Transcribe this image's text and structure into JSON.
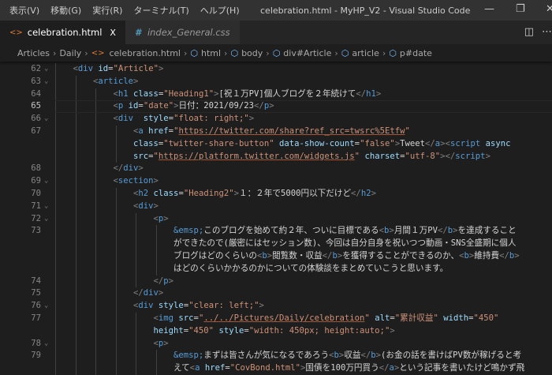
{
  "menu": [
    "表示(V)",
    "移動(G)",
    "実行(R)",
    "ターミナル(T)",
    "ヘルプ(H)"
  ],
  "window_title": "celebration.html - MyHP_V2 - Visual Studio Code",
  "tabs": [
    {
      "label": "celebration.html",
      "close": "X",
      "active": true
    },
    {
      "label": "index_General.css",
      "active": false
    }
  ],
  "breadcrumb": [
    "Articles",
    "Daily",
    "celebration.html",
    "html",
    "body",
    "div#Article",
    "article",
    "p#date"
  ],
  "current_line": 65,
  "lines": [
    {
      "n": 62,
      "fold": true,
      "indent": 1,
      "rows": [
        [
          [
            "<",
            "p"
          ],
          [
            "div",
            "t"
          ],
          [
            " id",
            "a"
          ],
          [
            "=",
            "x"
          ],
          [
            "\"Article\"",
            "s"
          ],
          [
            ">",
            "p"
          ]
        ]
      ]
    },
    {
      "n": 63,
      "fold": true,
      "indent": 2,
      "rows": [
        [
          [
            "<",
            "p"
          ],
          [
            "article",
            "t"
          ],
          [
            ">",
            "p"
          ]
        ]
      ]
    },
    {
      "n": 64,
      "fold": false,
      "indent": 3,
      "rows": [
        [
          [
            "<",
            "p"
          ],
          [
            "h1",
            "t"
          ],
          [
            " class",
            "a"
          ],
          [
            "=",
            "x"
          ],
          [
            "\"Heading1\"",
            "s"
          ],
          [
            ">",
            "p"
          ],
          [
            "[祝１万PV]個人ブログを２年続けて",
            "x"
          ],
          [
            "</",
            "p"
          ],
          [
            "h1",
            "t"
          ],
          [
            ">",
            "p"
          ]
        ]
      ]
    },
    {
      "n": 65,
      "fold": false,
      "indent": 3,
      "rows": [
        [
          [
            "<",
            "p"
          ],
          [
            "p",
            "t"
          ],
          [
            " id",
            "a"
          ],
          [
            "=",
            "x"
          ],
          [
            "\"date\"",
            "s"
          ],
          [
            ">",
            "p"
          ],
          [
            "日付：2021/09/23",
            "x"
          ],
          [
            "</",
            "p"
          ],
          [
            "p",
            "t"
          ],
          [
            ">",
            "p"
          ]
        ]
      ]
    },
    {
      "n": 66,
      "fold": true,
      "indent": 3,
      "rows": [
        [
          [
            "<",
            "p"
          ],
          [
            "div",
            "t"
          ],
          [
            "  style",
            "a"
          ],
          [
            "=",
            "x"
          ],
          [
            "\"float: right;\"",
            "s"
          ],
          [
            ">",
            "p"
          ]
        ]
      ]
    },
    {
      "n": 67,
      "fold": false,
      "indent": 4,
      "rows": [
        [
          [
            "<",
            "p"
          ],
          [
            "a",
            "t"
          ],
          [
            " href",
            "a"
          ],
          [
            "=",
            "x"
          ],
          [
            "\"",
            "s"
          ],
          [
            "https://twitter.com/share?ref_src=twsrc%5Etfw",
            "u"
          ],
          [
            "\"",
            "s"
          ]
        ],
        [
          [
            "class",
            "a"
          ],
          [
            "=",
            "x"
          ],
          [
            "\"twitter-share-button\"",
            "s"
          ],
          [
            " data-show-count",
            "a"
          ],
          [
            "=",
            "x"
          ],
          [
            "\"false\"",
            "s"
          ],
          [
            ">",
            "p"
          ],
          [
            "Tweet",
            "x"
          ],
          [
            "</",
            "p"
          ],
          [
            "a",
            "t"
          ],
          [
            ">",
            "p"
          ],
          [
            "<",
            "p"
          ],
          [
            "script",
            "t"
          ],
          [
            " async",
            "a"
          ]
        ],
        [
          [
            "src",
            "a"
          ],
          [
            "=",
            "x"
          ],
          [
            "\"",
            "s"
          ],
          [
            "https://platform.twitter.com/widgets.js",
            "u"
          ],
          [
            "\"",
            "s"
          ],
          [
            " charset",
            "a"
          ],
          [
            "=",
            "x"
          ],
          [
            "\"utf-8\"",
            "s"
          ],
          [
            "></",
            "p"
          ],
          [
            "script",
            "t"
          ],
          [
            ">",
            "p"
          ]
        ]
      ]
    },
    {
      "n": 68,
      "fold": false,
      "indent": 3,
      "rows": [
        [
          [
            "</",
            "p"
          ],
          [
            "div",
            "t"
          ],
          [
            ">",
            "p"
          ]
        ]
      ]
    },
    {
      "n": 69,
      "fold": true,
      "indent": 3,
      "rows": [
        [
          [
            "<",
            "p"
          ],
          [
            "section",
            "t"
          ],
          [
            ">",
            "p"
          ]
        ]
      ]
    },
    {
      "n": 70,
      "fold": false,
      "indent": 4,
      "rows": [
        [
          [
            "<",
            "p"
          ],
          [
            "h2",
            "t"
          ],
          [
            " class",
            "a"
          ],
          [
            "=",
            "x"
          ],
          [
            "\"Heading2\"",
            "s"
          ],
          [
            ">",
            "p"
          ],
          [
            "１：２年で5000円以下だけど",
            "x"
          ],
          [
            "</",
            "p"
          ],
          [
            "h2",
            "t"
          ],
          [
            ">",
            "p"
          ]
        ]
      ]
    },
    {
      "n": 71,
      "fold": true,
      "indent": 4,
      "rows": [
        [
          [
            "<",
            "p"
          ],
          [
            "div",
            "t"
          ],
          [
            ">",
            "p"
          ]
        ]
      ]
    },
    {
      "n": 72,
      "fold": true,
      "indent": 5,
      "rows": [
        [
          [
            "<",
            "p"
          ],
          [
            "p",
            "t"
          ],
          [
            ">",
            "p"
          ]
        ]
      ]
    },
    {
      "n": 73,
      "fold": false,
      "indent": 6,
      "rows": [
        [
          [
            "&emsp;",
            "e"
          ],
          [
            "このブログを始めて約２年、ついに目標である",
            "x"
          ],
          [
            "<",
            "p"
          ],
          [
            "b",
            "t"
          ],
          [
            ">",
            "p"
          ],
          [
            "月間１万PV",
            "x"
          ],
          [
            "</",
            "p"
          ],
          [
            "b",
            "t"
          ],
          [
            ">",
            "p"
          ],
          [
            "を達成すること",
            "x"
          ]
        ],
        [
          [
            "ができたので(厳密にはセッション数)、今回は自分自身を祝いつつ動画・SNS全盛期に個人",
            "x"
          ]
        ],
        [
          [
            "ブログはどのくらいの",
            "x"
          ],
          [
            "<",
            "p"
          ],
          [
            "b",
            "t"
          ],
          [
            ">",
            "p"
          ],
          [
            "閲覧数・収益",
            "x"
          ],
          [
            "</",
            "p"
          ],
          [
            "b",
            "t"
          ],
          [
            ">",
            "p"
          ],
          [
            "を獲得することができるのか、",
            "x"
          ],
          [
            "<",
            "p"
          ],
          [
            "b",
            "t"
          ],
          [
            ">",
            "p"
          ],
          [
            "維持費",
            "x"
          ],
          [
            "</",
            "p"
          ],
          [
            "b",
            "t"
          ],
          [
            ">",
            "p"
          ]
        ],
        [
          [
            "はどのくらいかかるのかについての体験談をまとめていこうと思います。",
            "x"
          ]
        ]
      ]
    },
    {
      "n": 74,
      "fold": false,
      "indent": 5,
      "rows": [
        [
          [
            "</",
            "p"
          ],
          [
            "p",
            "t"
          ],
          [
            ">",
            "p"
          ]
        ]
      ]
    },
    {
      "n": 75,
      "fold": false,
      "indent": 4,
      "rows": [
        [
          [
            "</",
            "p"
          ],
          [
            "div",
            "t"
          ],
          [
            ">",
            "p"
          ]
        ]
      ]
    },
    {
      "n": 76,
      "fold": true,
      "indent": 4,
      "rows": [
        [
          [
            "<",
            "p"
          ],
          [
            "div",
            "t"
          ],
          [
            " style",
            "a"
          ],
          [
            "=",
            "x"
          ],
          [
            "\"clear: left;\"",
            "s"
          ],
          [
            ">",
            "p"
          ]
        ]
      ]
    },
    {
      "n": 77,
      "fold": false,
      "indent": 5,
      "rows": [
        [
          [
            "<",
            "p"
          ],
          [
            "img",
            "t"
          ],
          [
            " src",
            "a"
          ],
          [
            "=",
            "x"
          ],
          [
            "\"",
            "s"
          ],
          [
            "../../Pictures/Daily/celebration",
            "u"
          ],
          [
            "\"",
            "s"
          ],
          [
            " alt",
            "a"
          ],
          [
            "=",
            "x"
          ],
          [
            "\"累計収益\"",
            "s"
          ],
          [
            " width",
            "a"
          ],
          [
            "=",
            "x"
          ],
          [
            "\"450\"",
            "s"
          ]
        ],
        [
          [
            "height",
            "a"
          ],
          [
            "=",
            "x"
          ],
          [
            "\"450\"",
            "s"
          ],
          [
            " style",
            "a"
          ],
          [
            "=",
            "x"
          ],
          [
            "\"width: 450px; height:auto;\"",
            "s"
          ],
          [
            ">",
            "p"
          ]
        ]
      ]
    },
    {
      "n": 78,
      "fold": true,
      "indent": 5,
      "rows": [
        [
          [
            "<",
            "p"
          ],
          [
            "p",
            "t"
          ],
          [
            ">",
            "p"
          ]
        ]
      ]
    },
    {
      "n": 79,
      "fold": false,
      "indent": 6,
      "rows": [
        [
          [
            "&emsp;",
            "e"
          ],
          [
            "まずは皆さんが気になるであろう",
            "x"
          ],
          [
            "<",
            "p"
          ],
          [
            "b",
            "t"
          ],
          [
            ">",
            "p"
          ],
          [
            "収益",
            "x"
          ],
          [
            "</",
            "p"
          ],
          [
            "b",
            "t"
          ],
          [
            ">",
            "p"
          ],
          [
            "(お金の話を書けばPV数が稼げると考",
            "x"
          ]
        ],
        [
          [
            "えて",
            "x"
          ],
          [
            "<",
            "p"
          ],
          [
            "a",
            "t"
          ],
          [
            " href",
            "a"
          ],
          [
            "=",
            "x"
          ],
          [
            "\"CovBond.html\"",
            "s"
          ],
          [
            ">",
            "p"
          ],
          [
            "国債を100万円買う",
            "x"
          ],
          [
            "</",
            "p"
          ],
          [
            "a",
            "t"
          ],
          [
            ">",
            "p"
          ],
          [
            "という記事を書いたけど鳴かず飛",
            "x"
          ]
        ]
      ]
    }
  ]
}
